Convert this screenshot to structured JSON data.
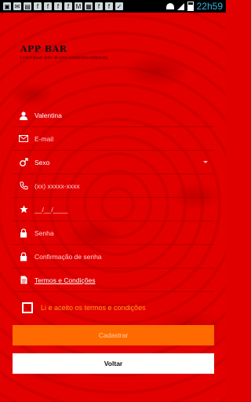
{
  "status_bar": {
    "notifications": [
      "bag-icon",
      "chat-icon",
      "photo-icon",
      "facebook-icon",
      "facebook-icon",
      "facebook-icon",
      "facebook-icon",
      "gmail-icon",
      "image-icon",
      "facebook-icon",
      "facebook-icon",
      "checkbox-icon"
    ],
    "time": "22h59"
  },
  "logo": {
    "title": "APP BAR",
    "subtitle": "Lorem ipsum dolor sit amet consectetur adipiscing"
  },
  "form": {
    "name_value": "Valentina",
    "email_placeholder": "E-mail",
    "gender_value": "Sexo",
    "phone_placeholder": "(xx) xxxxx-xxxx",
    "birthdate_placeholder": "__/__/____",
    "password_placeholder": "Senha",
    "password_confirm_placeholder": "Confirmação de senha",
    "terms_link": "Termos e Condições",
    "agree_label": "Li e aceito os termos e condições"
  },
  "buttons": {
    "register": "Cadastrar",
    "back": "Voltar"
  },
  "colors": {
    "background": "#e30000",
    "accent_orange": "#ff6a00",
    "status_time": "#33b5e5"
  }
}
